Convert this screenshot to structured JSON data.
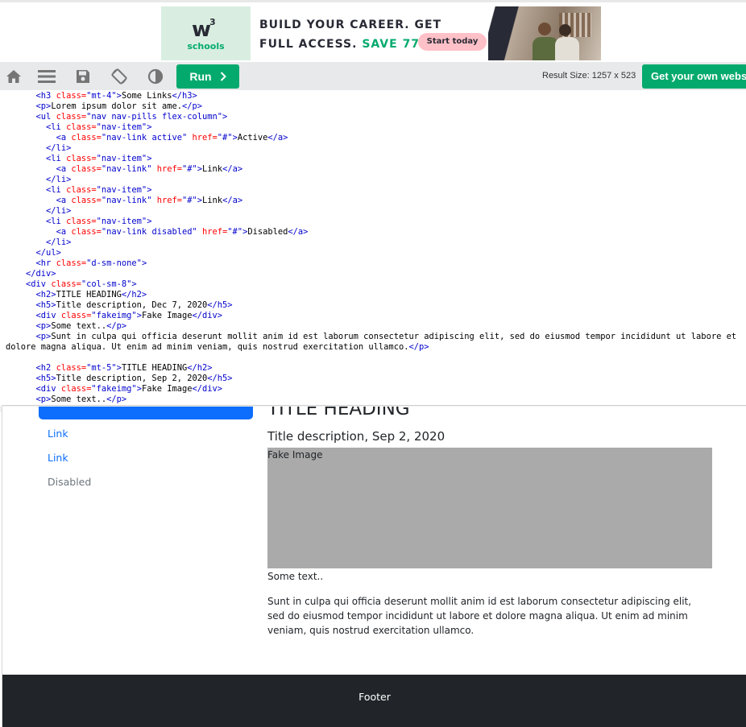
{
  "ad": {
    "logo_mark": "w",
    "logo_sup": "3",
    "logo_sub": "schools",
    "line1": "BUILD YOUR CAREER. GET",
    "line2_a": "FULL ACCESS. ",
    "line2_b": "SAVE 770$",
    "cta": "Start today",
    "close": "×"
  },
  "toolbar": {
    "run_label": "Run",
    "result_size": "Result Size: 1257 x 523",
    "get_own_label": "Get your own website"
  },
  "code": [
    [
      {
        "t": "      "
      },
      {
        "c": "tg",
        "t": "<h3 "
      },
      {
        "c": "at",
        "t": "class="
      },
      {
        "c": "st",
        "t": "\"mt-4\""
      },
      {
        "c": "tg",
        "t": ">"
      },
      {
        "t": "Some Links"
      },
      {
        "c": "tg",
        "t": "</h3>"
      }
    ],
    [
      {
        "t": "      "
      },
      {
        "c": "tg",
        "t": "<p>"
      },
      {
        "t": "Lorem ipsum dolor sit ame."
      },
      {
        "c": "tg",
        "t": "</p>"
      }
    ],
    [
      {
        "t": "      "
      },
      {
        "c": "tg",
        "t": "<ul "
      },
      {
        "c": "at",
        "t": "class="
      },
      {
        "c": "st",
        "t": "\"nav nav-pills flex-column\""
      },
      {
        "c": "tg",
        "t": ">"
      }
    ],
    [
      {
        "t": "        "
      },
      {
        "c": "tg",
        "t": "<li "
      },
      {
        "c": "at",
        "t": "class="
      },
      {
        "c": "st",
        "t": "\"nav-item\""
      },
      {
        "c": "tg",
        "t": ">"
      }
    ],
    [
      {
        "t": "          "
      },
      {
        "c": "tg",
        "t": "<a "
      },
      {
        "c": "at",
        "t": "class="
      },
      {
        "c": "st",
        "t": "\"nav-link active\""
      },
      {
        "c": "at",
        "t": " href="
      },
      {
        "c": "st",
        "t": "\"#\""
      },
      {
        "c": "tg",
        "t": ">"
      },
      {
        "t": "Active"
      },
      {
        "c": "tg",
        "t": "</a>"
      }
    ],
    [
      {
        "t": "        "
      },
      {
        "c": "tg",
        "t": "</li>"
      }
    ],
    [
      {
        "t": "        "
      },
      {
        "c": "tg",
        "t": "<li "
      },
      {
        "c": "at",
        "t": "class="
      },
      {
        "c": "st",
        "t": "\"nav-item\""
      },
      {
        "c": "tg",
        "t": ">"
      }
    ],
    [
      {
        "t": "          "
      },
      {
        "c": "tg",
        "t": "<a "
      },
      {
        "c": "at",
        "t": "class="
      },
      {
        "c": "st",
        "t": "\"nav-link\""
      },
      {
        "c": "at",
        "t": " href="
      },
      {
        "c": "st",
        "t": "\"#\""
      },
      {
        "c": "tg",
        "t": ">"
      },
      {
        "t": "Link"
      },
      {
        "c": "tg",
        "t": "</a>"
      }
    ],
    [
      {
        "t": "        "
      },
      {
        "c": "tg",
        "t": "</li>"
      }
    ],
    [
      {
        "t": "        "
      },
      {
        "c": "tg",
        "t": "<li "
      },
      {
        "c": "at",
        "t": "class="
      },
      {
        "c": "st",
        "t": "\"nav-item\""
      },
      {
        "c": "tg",
        "t": ">"
      }
    ],
    [
      {
        "t": "          "
      },
      {
        "c": "tg",
        "t": "<a "
      },
      {
        "c": "at",
        "t": "class="
      },
      {
        "c": "st",
        "t": "\"nav-link\""
      },
      {
        "c": "at",
        "t": " href="
      },
      {
        "c": "st",
        "t": "\"#\""
      },
      {
        "c": "tg",
        "t": ">"
      },
      {
        "t": "Link"
      },
      {
        "c": "tg",
        "t": "</a>"
      }
    ],
    [
      {
        "t": "        "
      },
      {
        "c": "tg",
        "t": "</li>"
      }
    ],
    [
      {
        "t": "        "
      },
      {
        "c": "tg",
        "t": "<li "
      },
      {
        "c": "at",
        "t": "class="
      },
      {
        "c": "st",
        "t": "\"nav-item\""
      },
      {
        "c": "tg",
        "t": ">"
      }
    ],
    [
      {
        "t": "          "
      },
      {
        "c": "tg",
        "t": "<a "
      },
      {
        "c": "at",
        "t": "class="
      },
      {
        "c": "st",
        "t": "\"nav-link disabled\""
      },
      {
        "c": "at",
        "t": " href="
      },
      {
        "c": "st",
        "t": "\"#\""
      },
      {
        "c": "tg",
        "t": ">"
      },
      {
        "t": "Disabled"
      },
      {
        "c": "tg",
        "t": "</a>"
      }
    ],
    [
      {
        "t": "        "
      },
      {
        "c": "tg",
        "t": "</li>"
      }
    ],
    [
      {
        "t": "      "
      },
      {
        "c": "tg",
        "t": "</ul>"
      }
    ],
    [
      {
        "t": "      "
      },
      {
        "c": "tg",
        "t": "<hr "
      },
      {
        "c": "at",
        "t": "class="
      },
      {
        "c": "st",
        "t": "\"d-sm-none\""
      },
      {
        "c": "tg",
        "t": ">"
      }
    ],
    [
      {
        "t": "    "
      },
      {
        "c": "tg",
        "t": "</div>"
      }
    ],
    [
      {
        "t": "    "
      },
      {
        "c": "tg",
        "t": "<div "
      },
      {
        "c": "at",
        "t": "class="
      },
      {
        "c": "st",
        "t": "\"col-sm-8\""
      },
      {
        "c": "tg",
        "t": ">"
      }
    ],
    [
      {
        "t": "      "
      },
      {
        "c": "tg",
        "t": "<h2>"
      },
      {
        "t": "TITLE HEADING"
      },
      {
        "c": "tg",
        "t": "</h2>"
      }
    ],
    [
      {
        "t": "      "
      },
      {
        "c": "tg",
        "t": "<h5>"
      },
      {
        "t": "Title description, Dec 7, 2020"
      },
      {
        "c": "tg",
        "t": "</h5>"
      }
    ],
    [
      {
        "t": "      "
      },
      {
        "c": "tg",
        "t": "<div "
      },
      {
        "c": "at",
        "t": "class="
      },
      {
        "c": "st",
        "t": "\"fakeimg\""
      },
      {
        "c": "tg",
        "t": ">"
      },
      {
        "t": "Fake Image"
      },
      {
        "c": "tg",
        "t": "</div>"
      }
    ],
    [
      {
        "t": "      "
      },
      {
        "c": "tg",
        "t": "<p>"
      },
      {
        "t": "Some text.."
      },
      {
        "c": "tg",
        "t": "</p>"
      }
    ],
    [
      {
        "t": "      "
      },
      {
        "c": "tg",
        "t": "<p>"
      },
      {
        "t": "Sunt in culpa qui officia deserunt mollit anim id est laborum consectetur adipiscing elit, sed do eiusmod tempor incididunt ut labore et"
      }
    ],
    [
      {
        "t": "dolore magna aliqua. Ut enim ad minim veniam, quis nostrud exercitation ullamco."
      },
      {
        "c": "tg",
        "t": "</p>"
      }
    ],
    [
      {
        "t": ""
      }
    ],
    [
      {
        "t": "      "
      },
      {
        "c": "tg",
        "t": "<h2 "
      },
      {
        "c": "at",
        "t": "class="
      },
      {
        "c": "st",
        "t": "\"mt-5\""
      },
      {
        "c": "tg",
        "t": ">"
      },
      {
        "t": "TITLE HEADING"
      },
      {
        "c": "tg",
        "t": "</h2>"
      }
    ],
    [
      {
        "t": "      "
      },
      {
        "c": "tg",
        "t": "<h5>"
      },
      {
        "t": "Title description, Sep 2, 2020"
      },
      {
        "c": "tg",
        "t": "</h5>"
      }
    ],
    [
      {
        "t": "      "
      },
      {
        "c": "tg",
        "t": "<div "
      },
      {
        "c": "at",
        "t": "class="
      },
      {
        "c": "st",
        "t": "\"fakeimg\""
      },
      {
        "c": "tg",
        "t": ">"
      },
      {
        "t": "Fake Image"
      },
      {
        "c": "tg",
        "t": "</div>"
      }
    ],
    [
      {
        "t": "      "
      },
      {
        "c": "tg",
        "t": "<p>"
      },
      {
        "t": "Some text.."
      },
      {
        "c": "tg",
        "t": "</p>"
      }
    ]
  ],
  "result": {
    "nav_links": [
      "Link",
      "Link",
      "Disabled"
    ],
    "heading": "TITLE HEADING",
    "description": "Title description, Sep 2, 2020",
    "fake_image": "Fake Image",
    "some_text": "Some text..",
    "paragraph": "Sunt in culpa qui officia deserunt mollit anim id est laborum consectetur adipiscing elit, sed do eiusmod tempor incididunt ut labore et dolore magna aliqua. Ut enim ad minim veniam, quis nostrud exercitation ullamco.",
    "footer": "Footer"
  },
  "colors": {
    "brand_green": "#04aa6d",
    "toolbar_bg": "#e7e9eb",
    "pill_blue": "#0d6efd",
    "footer_bg": "#212529",
    "fake_image_bg": "#aaaaaa"
  },
  "icons": [
    "home-icon",
    "menu-icon",
    "save-icon",
    "rotate-icon",
    "contrast-icon",
    "chevron-right-icon"
  ]
}
